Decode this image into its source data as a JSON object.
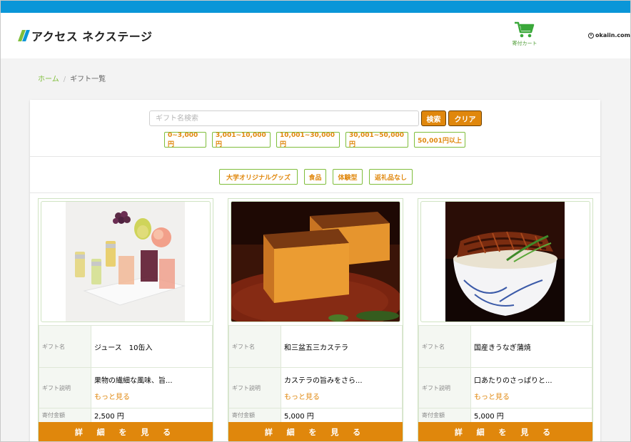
{
  "header": {
    "logo_text": "アクセス ネクステージ",
    "cart_label": "寄付カート",
    "brand2": "okaiin.com"
  },
  "breadcrumb": {
    "home": "ホーム",
    "separator": "/",
    "current": "ギフト一覧"
  },
  "search": {
    "placeholder": "ギフト名検索",
    "value": "",
    "search_button": "検索",
    "clear_button": "クリア"
  },
  "price_filters": [
    "0~3,000円",
    "3,001~10,000円",
    "10,001~30,000円",
    "30,001~50,000円",
    "50,001円以上"
  ],
  "categories": [
    "大学オリジナルグッズ",
    "食品",
    "体験型",
    "返礼品なし"
  ],
  "labels": {
    "gift_name": "ギフト名",
    "gift_desc": "ギフト説明",
    "amount": "寄付金額",
    "more": "もっと見る",
    "detail_button": "詳 細 を 見 る"
  },
  "gifts": [
    {
      "name": "ジュース　10缶入",
      "desc": "果物の繊細な風味、旨...",
      "amount": "2,500 円",
      "image": "juice-photo"
    },
    {
      "name": "和三盆五三カステラ",
      "desc": "カステラの旨みをさら...",
      "amount": "5,000 円",
      "image": "castella-photo"
    },
    {
      "name": "国産きうなぎ蒲焼",
      "desc": "口あたりのさっぱりと...",
      "amount": "5,000 円",
      "image": "unagi-photo"
    }
  ],
  "colors": {
    "topbar": "#0a96d8",
    "accent": "#e0870c",
    "green": "#7fbe3b"
  }
}
